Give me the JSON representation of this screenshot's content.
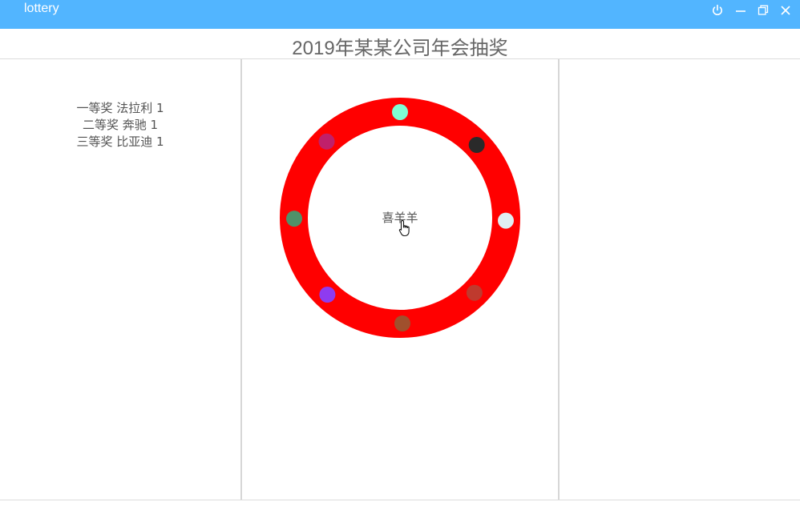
{
  "app": {
    "title": "lottery"
  },
  "window_controls": {
    "power_icon": "power-icon",
    "minimize_icon": "minimize-icon",
    "restore_icon": "restore-icon",
    "close_icon": "close-icon"
  },
  "header": {
    "title": "2019年某某公司年会抽奖"
  },
  "prizes": [
    {
      "text": "一等奖 法拉利 1"
    },
    {
      "text": "二等奖 奔驰 1"
    },
    {
      "text": "三等奖 比亚迪 1"
    }
  ],
  "wheel": {
    "ring_color": "#ff0000",
    "center_text": "喜羊羊",
    "dot_colors": [
      "#7fffd4",
      "#2a2a2a",
      "#e0eef2",
      "#bf3a2e",
      "#a0502d",
      "#8e3bf0",
      "#4f9169",
      "#c0206a"
    ]
  },
  "colors": {
    "titlebar": "#52b5ff",
    "divider": "#d6d6d6"
  }
}
